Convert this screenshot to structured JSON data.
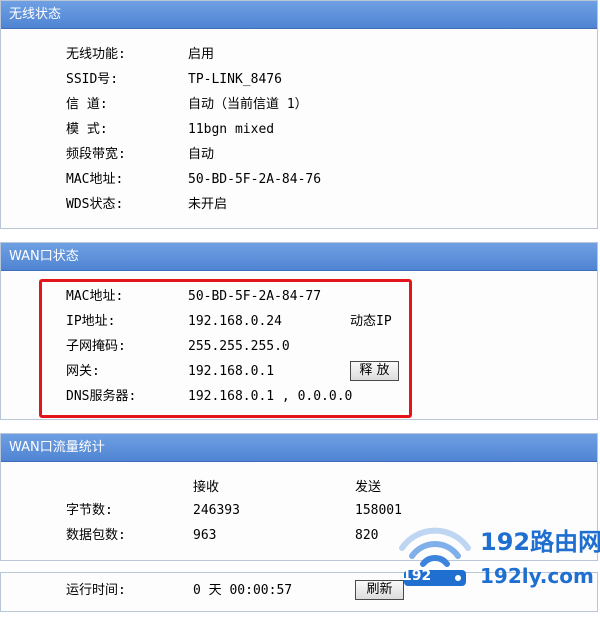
{
  "wireless": {
    "title": "无线状态",
    "rows": [
      {
        "label": "无线功能:",
        "value": "启用"
      },
      {
        "label": "SSID号:",
        "value": "TP-LINK_8476"
      },
      {
        "label": "信 道:",
        "value": "自动（当前信道 1）"
      },
      {
        "label": "模 式:",
        "value": "11bgn mixed"
      },
      {
        "label": "频段带宽:",
        "value": "自动"
      },
      {
        "label": "MAC地址:",
        "value": "50-BD-5F-2A-84-76"
      },
      {
        "label": "WDS状态:",
        "value": "未开启"
      }
    ]
  },
  "wan": {
    "title": "WAN口状态",
    "rows": [
      {
        "label": "MAC地址:",
        "value": "50-BD-5F-2A-84-77"
      },
      {
        "label": "IP地址:",
        "value": "192.168.0.24",
        "extra": "动态IP"
      },
      {
        "label": "子网掩码:",
        "value": "255.255.255.0"
      },
      {
        "label": "网关:",
        "value": "192.168.0.1"
      },
      {
        "label": "DNS服务器:",
        "value": "192.168.0.1 , 0.0.0.0"
      }
    ],
    "release_button": "释 放"
  },
  "traffic": {
    "title": "WAN口流量统计",
    "col_receive": "接收",
    "col_send": "发送",
    "rows": [
      {
        "label": "字节数:",
        "receive": "246393",
        "send": "158001"
      },
      {
        "label": "数据包数:",
        "receive": "963",
        "send": "820"
      }
    ]
  },
  "uptime": {
    "label": "运行时间:",
    "value": "0 天 00:00:57",
    "refresh_button": "刷新"
  },
  "watermark": {
    "brand": "192路由网",
    "domain_a": "192",
    "domain_b": "192ly.com"
  },
  "colors": {
    "header": "#4f84d3",
    "highlight": "#e4141b",
    "logo": "#1f6fd1"
  }
}
